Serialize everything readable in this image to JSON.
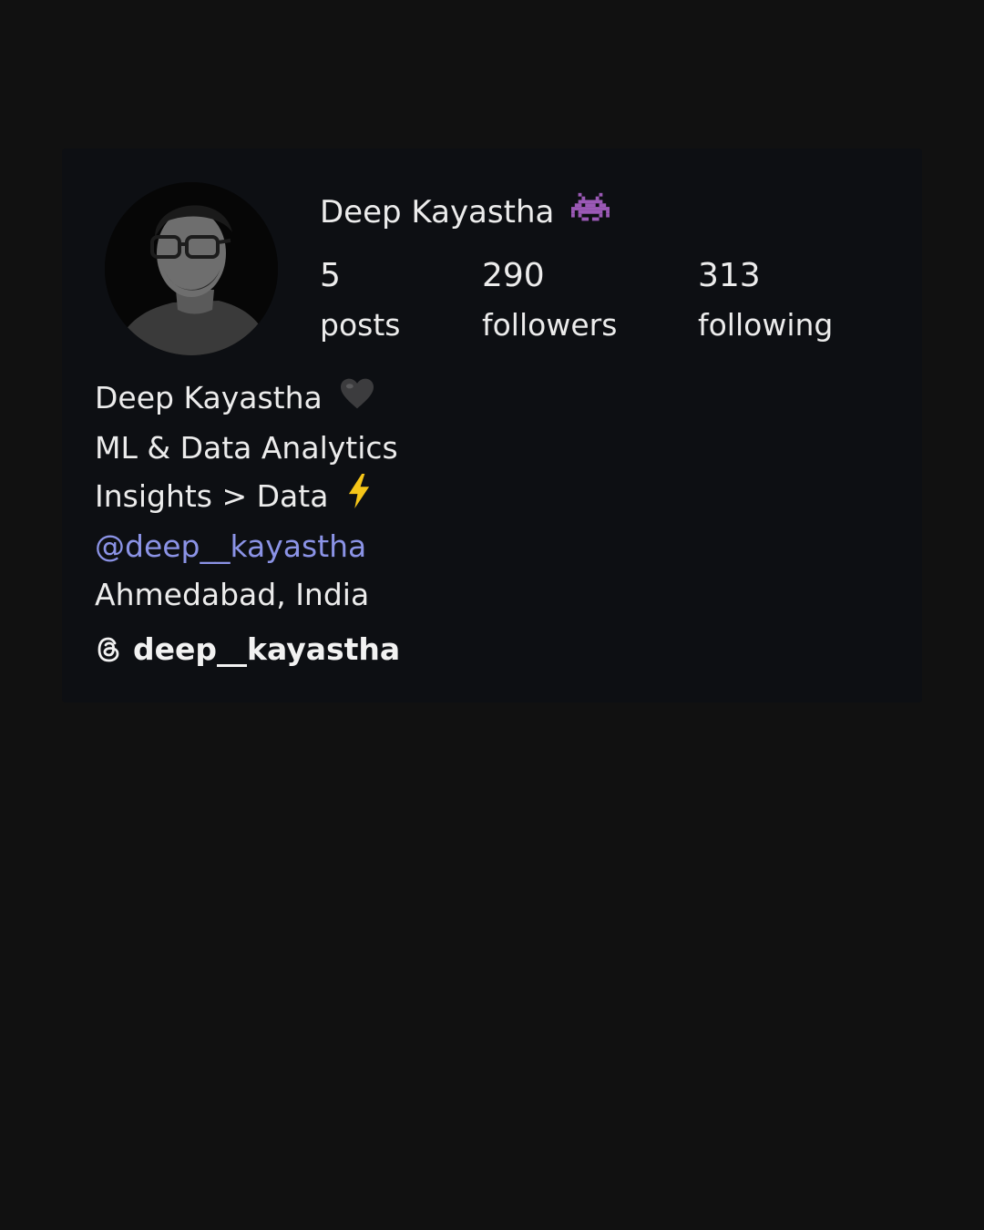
{
  "profile": {
    "display_name": "Deep Kayastha",
    "display_name_emoji": "alien-monster-icon",
    "avatar": "profile-photo",
    "stats": {
      "posts": {
        "count": "5",
        "label": "posts"
      },
      "followers": {
        "count": "290",
        "label": "followers"
      },
      "following": {
        "count": "313",
        "label": "following"
      }
    },
    "bio": {
      "name_line": "Deep Kayastha",
      "name_line_emoji": "black-heart-icon",
      "line2": "ML & Data Analytics",
      "line3": "Insights > Data",
      "line3_emoji": "lightning-icon",
      "mention": "@deep__kayastha",
      "location": "Ahmedabad, India"
    },
    "threads": {
      "icon": "threads-icon",
      "handle": "deep__kayastha"
    }
  },
  "colors": {
    "page_background": "#111111",
    "card_background": "#0d0f13",
    "text": "#ececec",
    "mention": "#8b93e6"
  }
}
